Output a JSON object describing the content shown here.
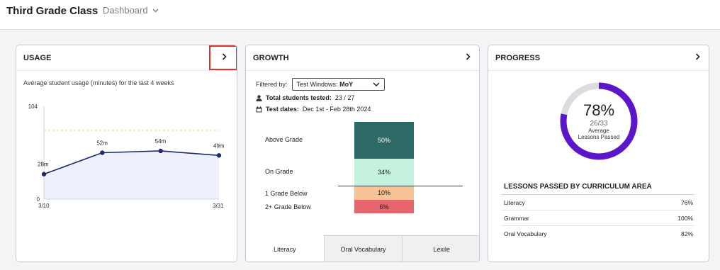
{
  "header": {
    "title": "Third Grade Class",
    "view_label": "Dashboard"
  },
  "usage": {
    "title": "USAGE",
    "subtitle": "Average student usage (minutes) for the last 4 weeks"
  },
  "growth": {
    "title": "GROWTH",
    "filter_label": "Filtered by:",
    "filter_prefix": "Test Windows:",
    "filter_value": "MoY",
    "students_label": "Total students tested:",
    "students_value": "23 / 27",
    "dates_label": "Test dates:",
    "dates_value": "Dec 1st - Feb 28th 2024",
    "grades": [
      {
        "label": "Above Grade",
        "value": "50%",
        "color": "#2d6a66"
      },
      {
        "label": "On Grade",
        "value": "34%",
        "color": "#c5f2de"
      },
      {
        "label": "1 Grade Below",
        "value": "10%",
        "color": "#f6c394"
      },
      {
        "label": "2+ Grade Below",
        "value": "6%",
        "color": "#e5666d"
      }
    ],
    "tabs": [
      "Literacy",
      "Oral Vocabulary",
      "Lexile"
    ],
    "active_tab": "Literacy"
  },
  "progress": {
    "title": "PROGRESS",
    "percent_label": "78%",
    "percent_value": 0.78,
    "fraction": "26/33",
    "caption_line1": "Average",
    "caption_line2": "Lessons Passed",
    "accent_color": "#5a16c8",
    "track_color": "#dcdce0",
    "areas_title": "LESSONS PASSED BY CURRICULUM AREA",
    "areas": [
      {
        "name": "Literacy",
        "value": "76%"
      },
      {
        "name": "Grammar",
        "value": "100%"
      },
      {
        "name": "Oral Vocabulary",
        "value": "82%"
      }
    ]
  },
  "icons": {
    "chevron": "chevron-right-icon",
    "dropdown": "chevron-down-icon",
    "user": "user-icon",
    "calendar": "calendar-icon"
  },
  "chart_data": {
    "type": "area",
    "title": "",
    "xlabel": "",
    "ylabel": "",
    "x_tick_labels": [
      "3/10",
      "3/31"
    ],
    "y_tick_labels": [
      "0",
      "104"
    ],
    "ylim": [
      0,
      104
    ],
    "x": [
      0,
      1,
      2,
      3
    ],
    "values": [
      28,
      52,
      54,
      49
    ],
    "data_labels": [
      "28m",
      "52m",
      "54m",
      "49m"
    ],
    "reference_line": 77,
    "line_color": "#1f2a6e",
    "fill_color": "#eef0fb",
    "reference_color": "#e8d57a",
    "grid": false
  }
}
